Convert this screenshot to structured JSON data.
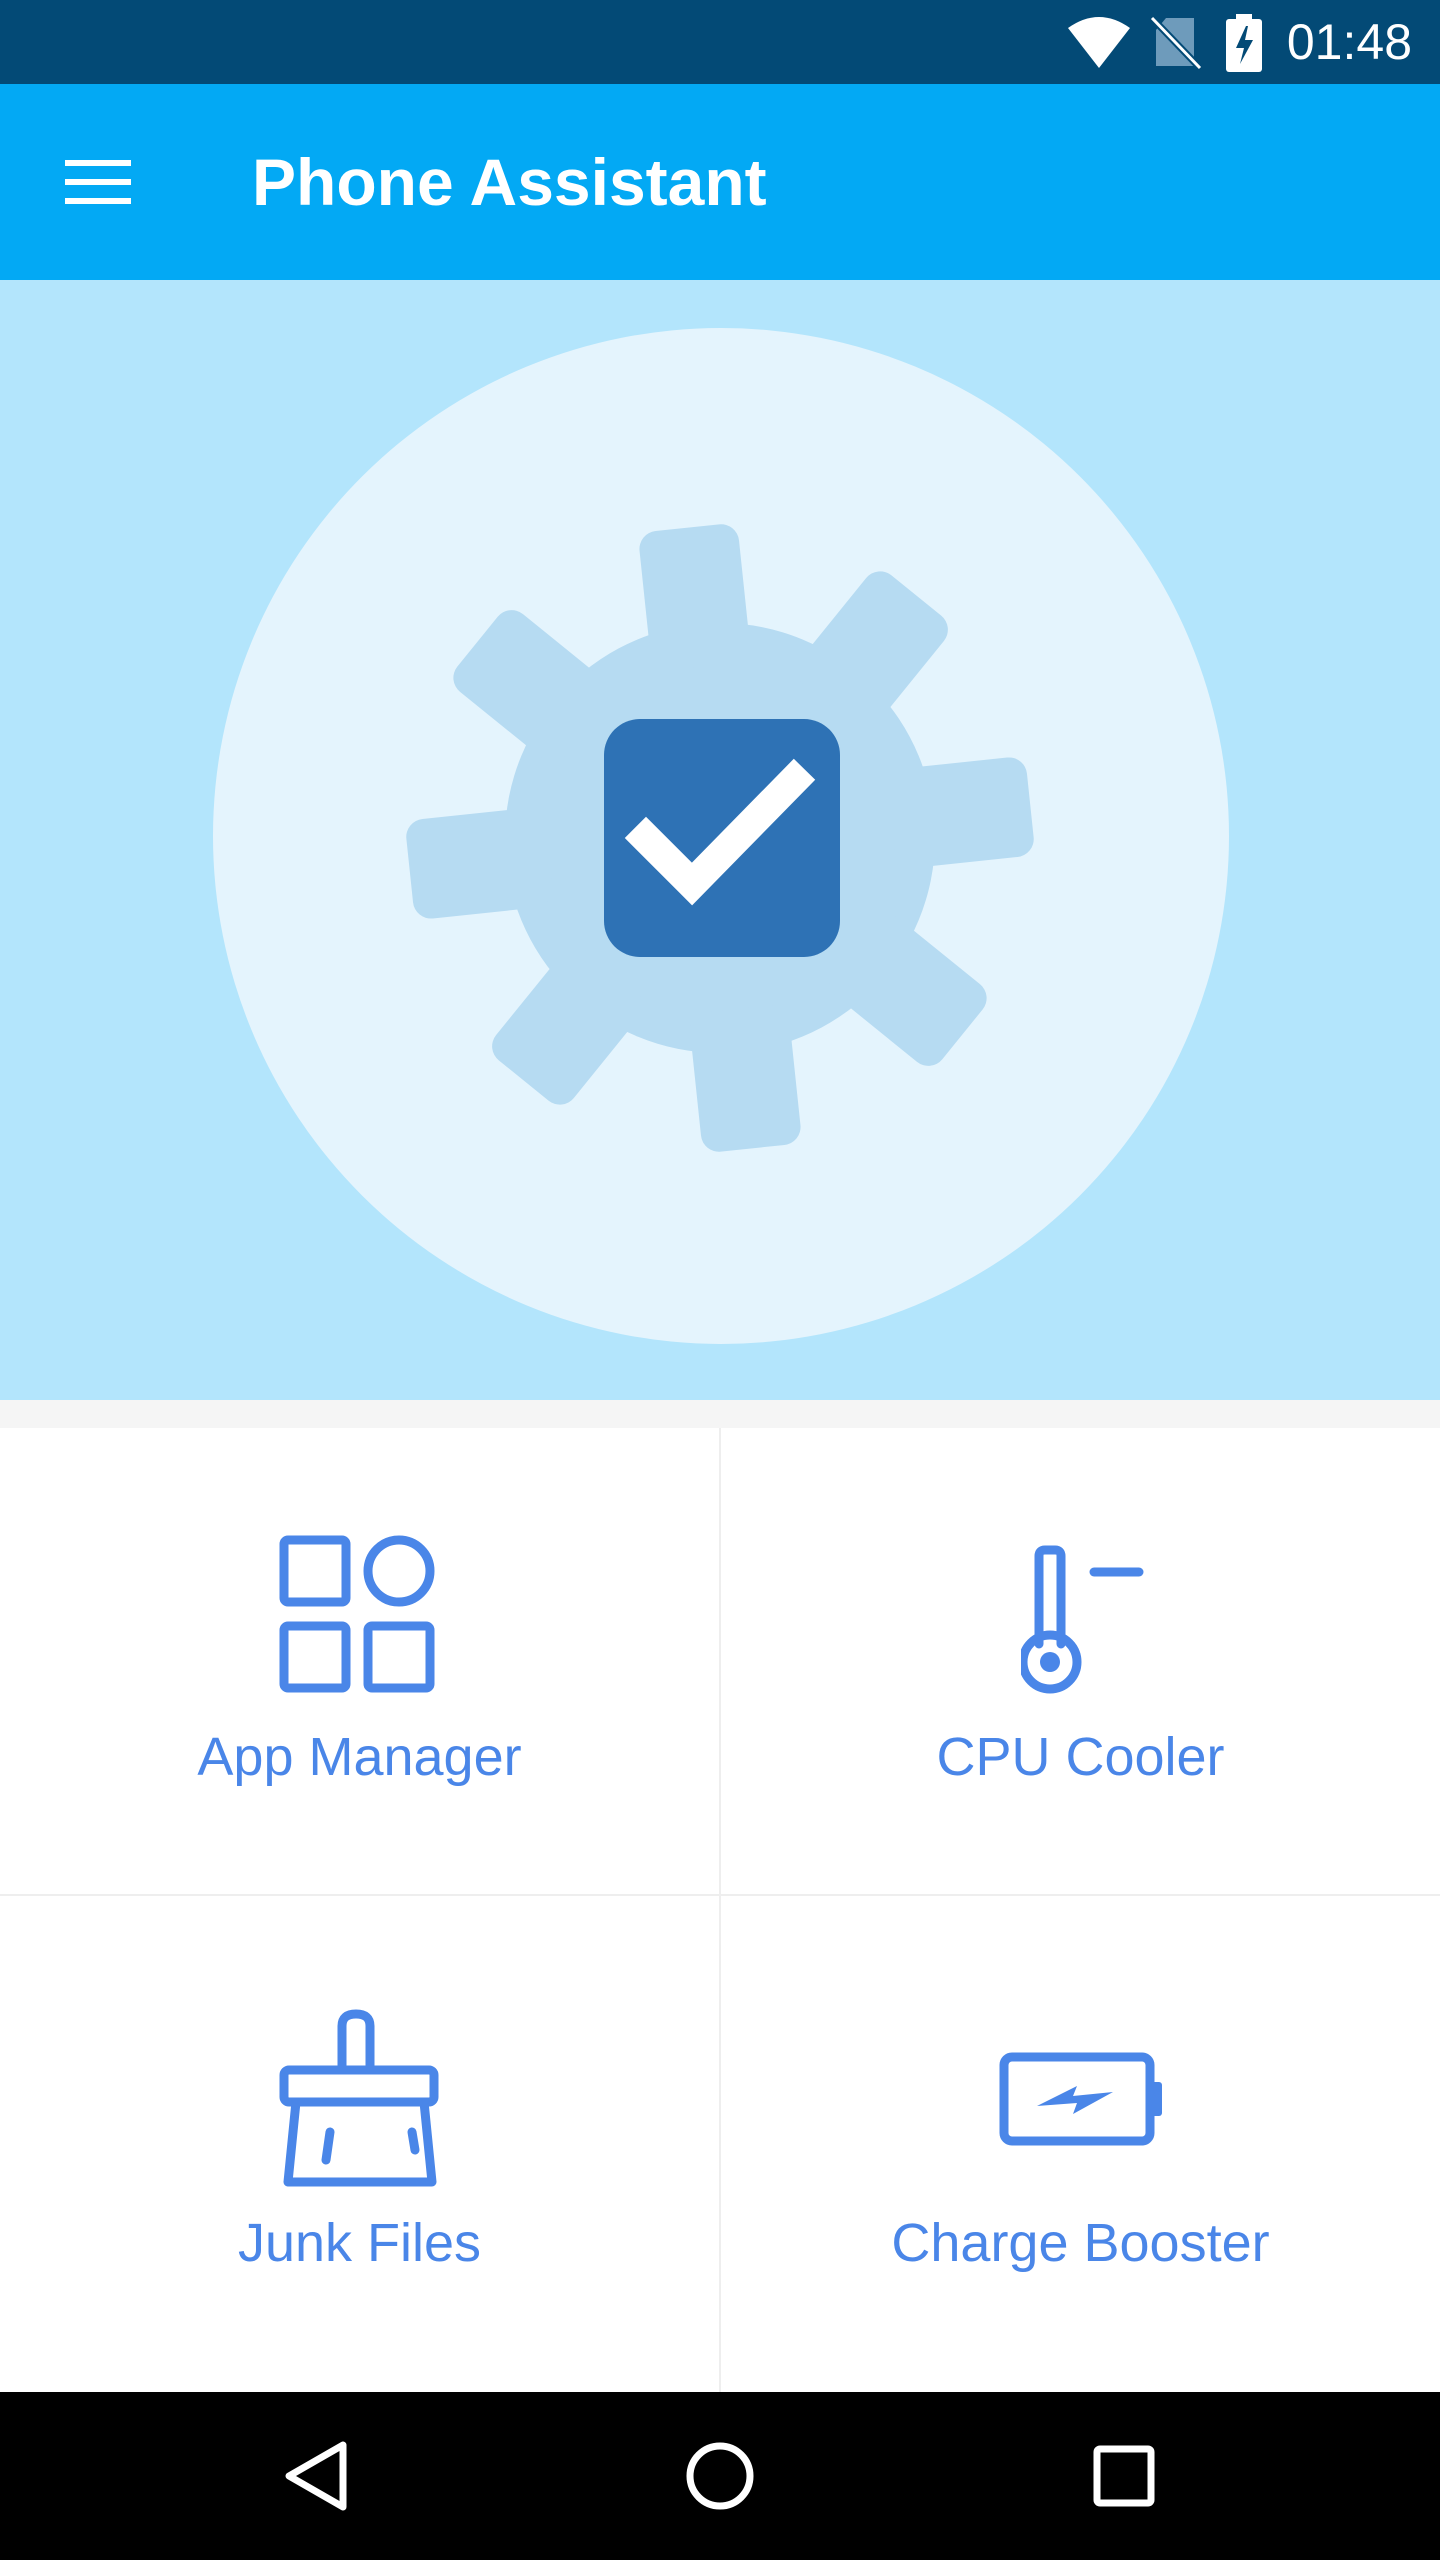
{
  "status_bar": {
    "time": "01:48",
    "icons": [
      "wifi-icon",
      "no-sim-icon",
      "battery-charging-icon"
    ]
  },
  "app_bar": {
    "title": "Phone Assistant",
    "menu_icon": "menu-icon"
  },
  "hero": {
    "icon": "gear-check-icon"
  },
  "features": [
    {
      "label": "App Manager",
      "icon": "app-grid-icon"
    },
    {
      "label": "CPU Cooler",
      "icon": "thermometer-icon"
    },
    {
      "label": "Junk Files",
      "icon": "broom-icon"
    },
    {
      "label": "Charge Booster",
      "icon": "charge-battery-icon"
    }
  ],
  "nav_bar": {
    "buttons": [
      "back-icon",
      "home-icon",
      "recents-icon"
    ]
  },
  "colors": {
    "status_bar": "#034a76",
    "app_bar": "#03a9f4",
    "hero_bg": "#b3e5fc",
    "hero_circle": "#e4f4fd",
    "gear": "#b6dbf2",
    "check_box": "#2e72b5",
    "accent": "#4a86e8"
  }
}
